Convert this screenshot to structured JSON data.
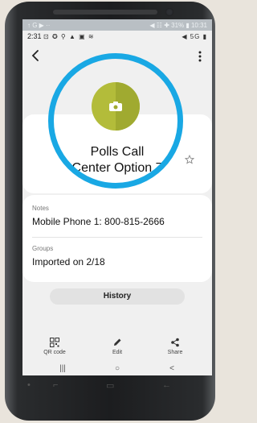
{
  "statusbar_top": {
    "left": "↑ G ▶ ··",
    "right": "◀ ☷ ✚ 31% ▮ 10:31"
  },
  "statusbar": {
    "time": "2:31",
    "left_icons": "⊡ ✪ ⚲ ▲ ▣ ≋",
    "right_icons": "◀ 5G ▮"
  },
  "contact": {
    "name_line1": "Polls Call",
    "name_line2": "Center Option 7",
    "avatar_color": "#b3bc3a",
    "highlight_ring_color": "#19a8e4"
  },
  "notes": {
    "label": "Notes",
    "value": "Mobile Phone 1: 800-815-2666"
  },
  "groups": {
    "label": "Groups",
    "value": "Imported on 2/18"
  },
  "history_label": "History",
  "actions": {
    "qr": "QR code",
    "edit": "Edit",
    "share": "Share"
  },
  "navbar": {
    "recent": "|||",
    "home": "○",
    "back": "<"
  }
}
